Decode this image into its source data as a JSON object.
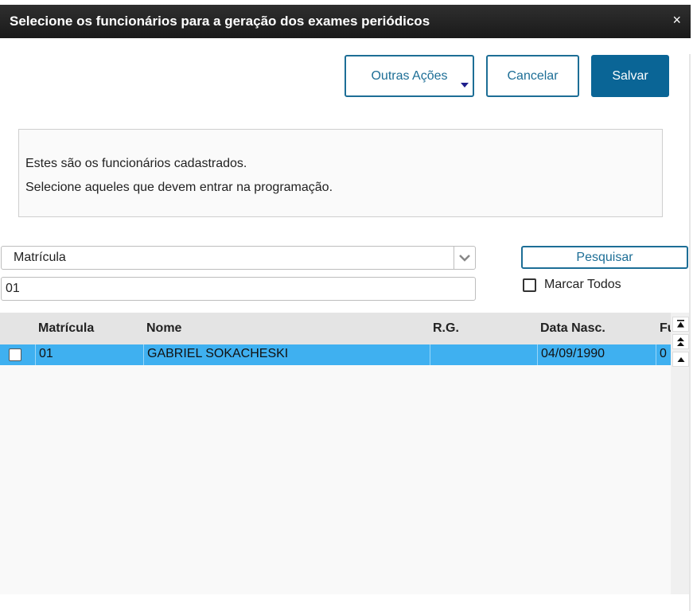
{
  "dialog": {
    "title": "Selecione os funcionários para a geração dos exames periódicos",
    "close_glyph": "×"
  },
  "toolbar": {
    "outras_label": "Outras Ações",
    "cancelar_label": "Cancelar",
    "salvar_label": "Salvar"
  },
  "info": {
    "line1": "Estes são os funcionários cadastrados.",
    "line2": "Selecione aqueles que devem entrar na programação."
  },
  "search": {
    "field_selected": "Matrícula",
    "value": "01",
    "button_label": "Pesquisar",
    "mark_all_label": "Marcar Todos"
  },
  "grid": {
    "columns": [
      "Matrícula",
      "Nome",
      "R.G.",
      "Data Nasc.",
      "Fu"
    ],
    "rows": [
      {
        "matricula": "01",
        "nome": "GABRIEL SOKACHESKI",
        "rg": "",
        "data_nasc": "04/09/1990",
        "fu": "0"
      }
    ]
  },
  "colors": {
    "accent": "#1d6e96",
    "primary_button": "#0a6596",
    "selected_row": "#3fb0f0",
    "title_bar": "#1a1a1a"
  },
  "icons": {
    "close": "close-icon",
    "dropdown": "chevron-down-icon",
    "scroll_first": "scroll-top-icon",
    "scroll_page_up": "scroll-page-up-icon",
    "scroll_up": "scroll-up-icon"
  }
}
